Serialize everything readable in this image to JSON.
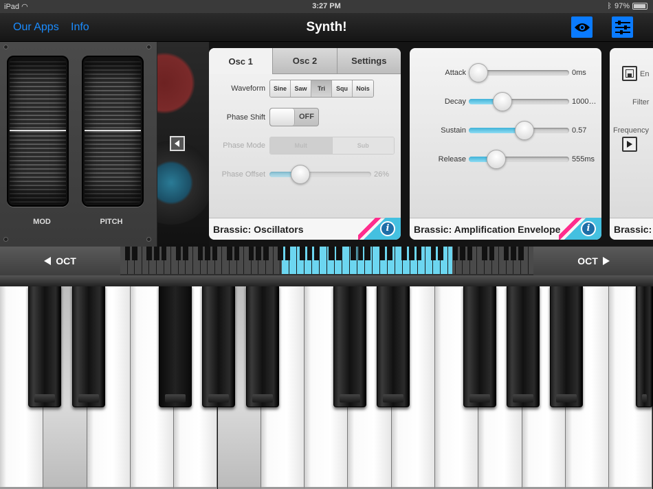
{
  "status_bar": {
    "device": "iPad",
    "time": "3:27 PM",
    "battery": "97%"
  },
  "nav": {
    "our_apps": "Our Apps",
    "info": "Info",
    "title": "Synth!",
    "eye_icon": "eye-icon",
    "settings_icon": "sliders-icon",
    "accent_color": "#0a7bff"
  },
  "wheels": {
    "mod_label": "MOD",
    "pitch_label": "PITCH"
  },
  "osc_card": {
    "tabs": [
      "Osc 1",
      "Osc 2",
      "Settings"
    ],
    "active_tab": "Osc 1",
    "waveform_label": "Waveform",
    "waveforms": [
      "Sine",
      "Saw",
      "Tri",
      "Squ",
      "Nois"
    ],
    "selected_waveform": "Tri",
    "phase_shift_label": "Phase Shift",
    "phase_shift_value": "OFF",
    "phase_mode_label": "Phase Mode",
    "phase_modes": [
      "Mult",
      "Sub"
    ],
    "phase_offset_label": "Phase Offset",
    "phase_offset_value": "26%",
    "phase_offset_fraction": 0.26,
    "footer": "Brassic: Oscillators"
  },
  "env_card": {
    "params": [
      {
        "label": "Attack",
        "value": "0ms",
        "fraction": 0.0
      },
      {
        "label": "Decay",
        "value": "1000…",
        "fraction": 0.3
      },
      {
        "label": "Sustain",
        "value": "0.57",
        "fraction": 0.57
      },
      {
        "label": "Release",
        "value": "555ms",
        "fraction": 0.22
      }
    ],
    "footer": "Brassic: Amplification Envelope"
  },
  "partial_card": {
    "line1": "En",
    "line2": "Filter",
    "line3": "Frequency",
    "footer": "Brassic:"
  },
  "octave_bar": {
    "left_label": "OCT",
    "right_label": "OCT",
    "highlight_color": "#6cd6f0"
  }
}
